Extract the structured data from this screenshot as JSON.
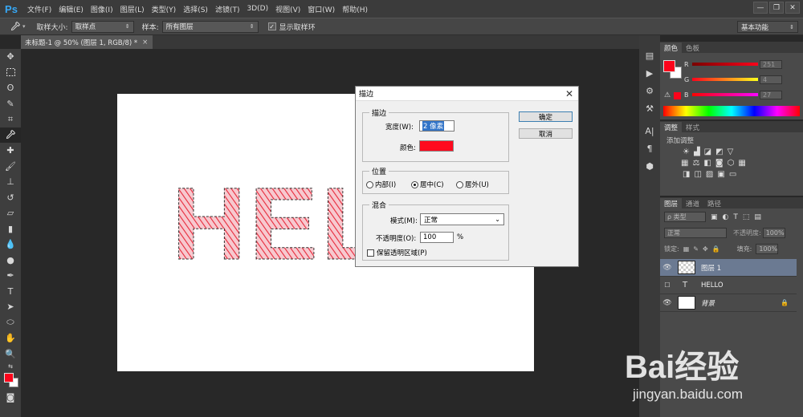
{
  "app": {
    "logo": "Ps"
  },
  "menu": [
    "文件(F)",
    "编辑(E)",
    "图像(I)",
    "图层(L)",
    "类型(Y)",
    "选择(S)",
    "滤镜(T)",
    "3D(D)",
    "视图(V)",
    "窗口(W)",
    "帮助(H)"
  ],
  "window_buttons": [
    "—",
    "❐",
    "✕"
  ],
  "options": {
    "sample_size_label": "取样大小:",
    "sample_size_value": "取样点",
    "sample_label": "样本:",
    "sample_value": "所有图层",
    "show_ring_label": "显示取样环",
    "workspace": "基本功能"
  },
  "document_tab": {
    "title": "未标题-1 @ 50% (图层 1, RGB/8) *",
    "close": "×"
  },
  "canvas_text": "HEL",
  "dialog": {
    "title": "描边",
    "stroke_group": "描边",
    "width_label": "宽度(W):",
    "width_value": "2 像素",
    "color_label": "颜色:",
    "color_value": "#ff0a1e",
    "position_group": "位置",
    "pos_inside": "内部(I)",
    "pos_center": "居中(C)",
    "pos_outside": "居外(U)",
    "blend_group": "混合",
    "mode_label": "模式(M):",
    "mode_value": "正常",
    "opacity_label": "不透明度(O):",
    "opacity_value": "100",
    "opacity_unit": "%",
    "preserve_label": "保留透明区域(P)",
    "ok": "确定",
    "cancel": "取消"
  },
  "color_panel": {
    "tabs": [
      "颜色",
      "色板"
    ],
    "channels": [
      {
        "ch": "R",
        "value": "251"
      },
      {
        "ch": "G",
        "value": "4"
      },
      {
        "ch": "B",
        "value": "27"
      }
    ]
  },
  "adjust_panel": {
    "tabs": [
      "调整",
      "样式"
    ],
    "title": "添加调整"
  },
  "layers_panel": {
    "tabs": [
      "图层",
      "通道",
      "路径"
    ],
    "filter": "ρ 类型",
    "blend_mode": "正常",
    "opacity_label": "不透明度:",
    "opacity_value": "100%",
    "lock_label": "锁定:",
    "fill_label": "填充:",
    "fill_value": "100%",
    "layers": [
      {
        "name": "图层 1",
        "selected": true,
        "visible": true
      },
      {
        "name": "HELLO",
        "selected": false,
        "visible": false
      },
      {
        "name": "背景",
        "selected": false,
        "visible": true
      }
    ]
  },
  "watermark": {
    "brand": "Bai经验",
    "url": "jingyan.baidu.com"
  }
}
